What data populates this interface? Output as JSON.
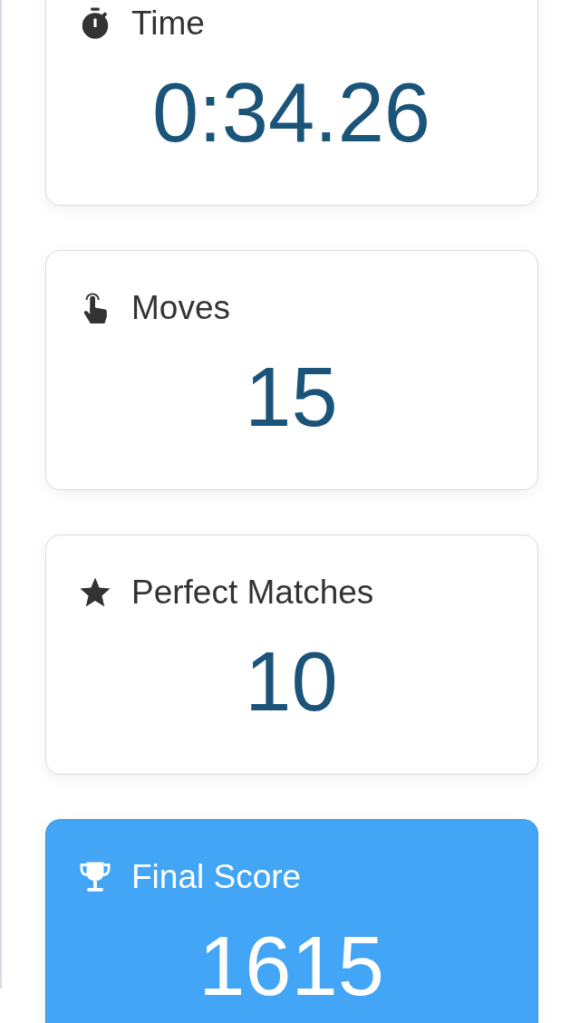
{
  "stats": [
    {
      "label": "Time",
      "value": "0:34.26",
      "highlighted": false
    },
    {
      "label": "Moves",
      "value": "15",
      "highlighted": false
    },
    {
      "label": "Perfect Matches",
      "value": "10",
      "highlighted": false
    },
    {
      "label": "Final Score",
      "value": "1615",
      "highlighted": true
    }
  ]
}
